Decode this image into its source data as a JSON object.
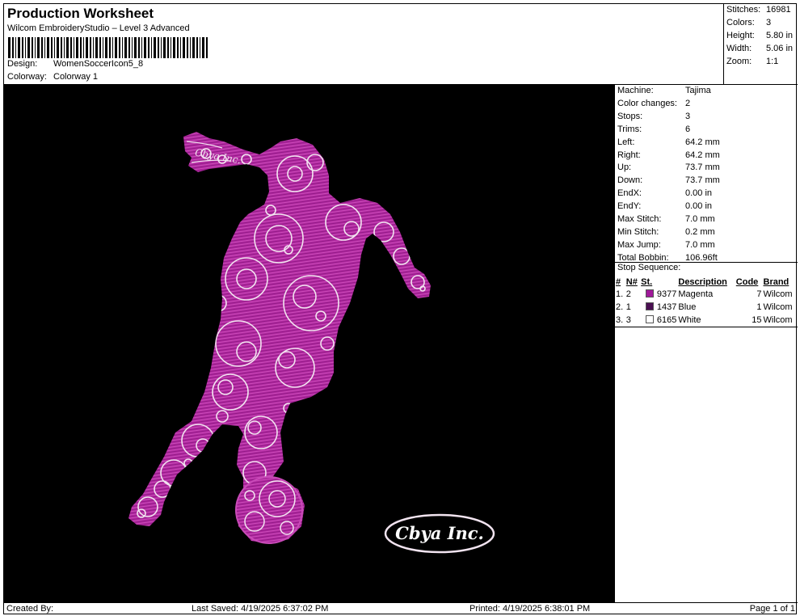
{
  "header": {
    "title": "Production Worksheet",
    "subtitle": "Wilcom EmbroideryStudio – Level 3 Advanced",
    "design_label": "Design:",
    "design_value": "WomenSoccerIcon5_8",
    "colorway_label": "Colorway:",
    "colorway_value": "Colorway 1"
  },
  "stats": [
    {
      "label": "Stitches:",
      "value": "16981"
    },
    {
      "label": "Colors:",
      "value": "3"
    },
    {
      "label": "Height:",
      "value": "5.80 in"
    },
    {
      "label": "Width:",
      "value": "5.06 in"
    },
    {
      "label": "Zoom:",
      "value": "1:1"
    }
  ],
  "machine_info": [
    {
      "label": "Machine:",
      "value": "Tajima"
    },
    {
      "label": "Color changes:",
      "value": "2"
    },
    {
      "label": "Stops:",
      "value": "3"
    },
    {
      "label": "Trims:",
      "value": "6"
    },
    {
      "label": "Left:",
      "value": "64.2 mm"
    },
    {
      "label": "Right:",
      "value": "64.2 mm"
    },
    {
      "label": "Up:",
      "value": "73.7 mm"
    },
    {
      "label": "Down:",
      "value": "73.7 mm"
    },
    {
      "label": "EndX:",
      "value": "0.00 in"
    },
    {
      "label": "EndY:",
      "value": "0.00 in"
    },
    {
      "label": "Max Stitch:",
      "value": "7.0 mm"
    },
    {
      "label": "Min Stitch:",
      "value": "0.2 mm"
    },
    {
      "label": "Max Jump:",
      "value": "7.0 mm"
    },
    {
      "label": "Total Bobbin:",
      "value": "106.96ft"
    }
  ],
  "stop_sequence": {
    "title": "Stop Sequence:",
    "headers": [
      "#",
      "N#",
      "St.",
      "Description",
      "Code",
      "Brand"
    ],
    "rows": [
      {
        "num": "1.",
        "n": "2",
        "color": "#a0199a",
        "st": "9377",
        "desc": "Magenta",
        "code": "7",
        "brand": "Wilcom"
      },
      {
        "num": "2.",
        "n": "1",
        "color": "#4a0f52",
        "st": "1437",
        "desc": "Blue",
        "code": "1",
        "brand": "Wilcom"
      },
      {
        "num": "3.",
        "n": "3",
        "color": "#ffffff",
        "st": "6165",
        "desc": "White",
        "code": "15",
        "brand": "Wilcom"
      }
    ]
  },
  "design": {
    "logo_text": "Cbya Inc.",
    "fill_color": "#b0279f",
    "outline_color": "#f2e4f0",
    "background": "#000000"
  },
  "footer": {
    "created_by": "Created By:",
    "last_saved": "Last Saved: 4/19/2025 6:37:02 PM",
    "printed": "Printed: 4/19/2025 6:38:01 PM",
    "page": "Page 1 of 1"
  }
}
